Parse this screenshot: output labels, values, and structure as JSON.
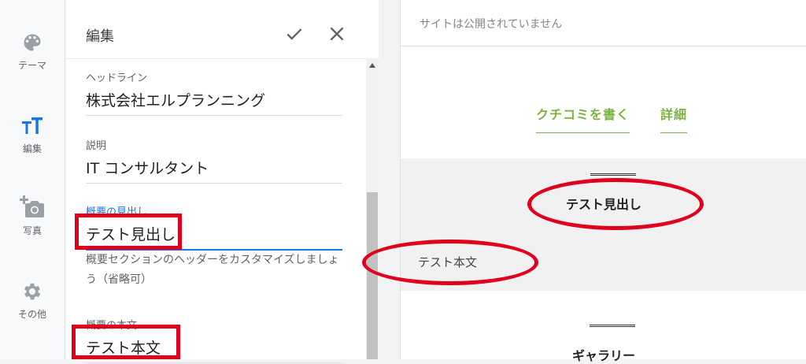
{
  "sidebar": {
    "items": [
      {
        "label": "テーマ",
        "icon": "palette-icon"
      },
      {
        "label": "編集",
        "icon": "text-format-icon"
      },
      {
        "label": "写真",
        "icon": "add-photo-icon"
      },
      {
        "label": "その他",
        "icon": "gear-icon"
      }
    ]
  },
  "editor": {
    "title": "編集",
    "fields": {
      "headline": {
        "label": "ヘッドライン",
        "value": "株式会社エルプランニング"
      },
      "description": {
        "label": "説明",
        "value": "IT コンサルタント"
      },
      "summary_heading": {
        "label": "概要の見出し",
        "value": "テスト見出し",
        "helper": "概要セクションのヘッダーをカスタマイズしましょう（省略可）"
      },
      "summary_body": {
        "label": "概要の本文",
        "value": "テスト本文"
      }
    }
  },
  "preview": {
    "notice": "サイトは公開されていません",
    "buttons": [
      "クチコミを書く",
      "詳細"
    ],
    "heading": "テスト見出し",
    "body": "テスト本文",
    "gallery": "ギャラリー"
  },
  "colors": {
    "annotation_red": "#e0001b",
    "accent_blue": "#1a73e8",
    "preview_green": "#7cb342"
  }
}
